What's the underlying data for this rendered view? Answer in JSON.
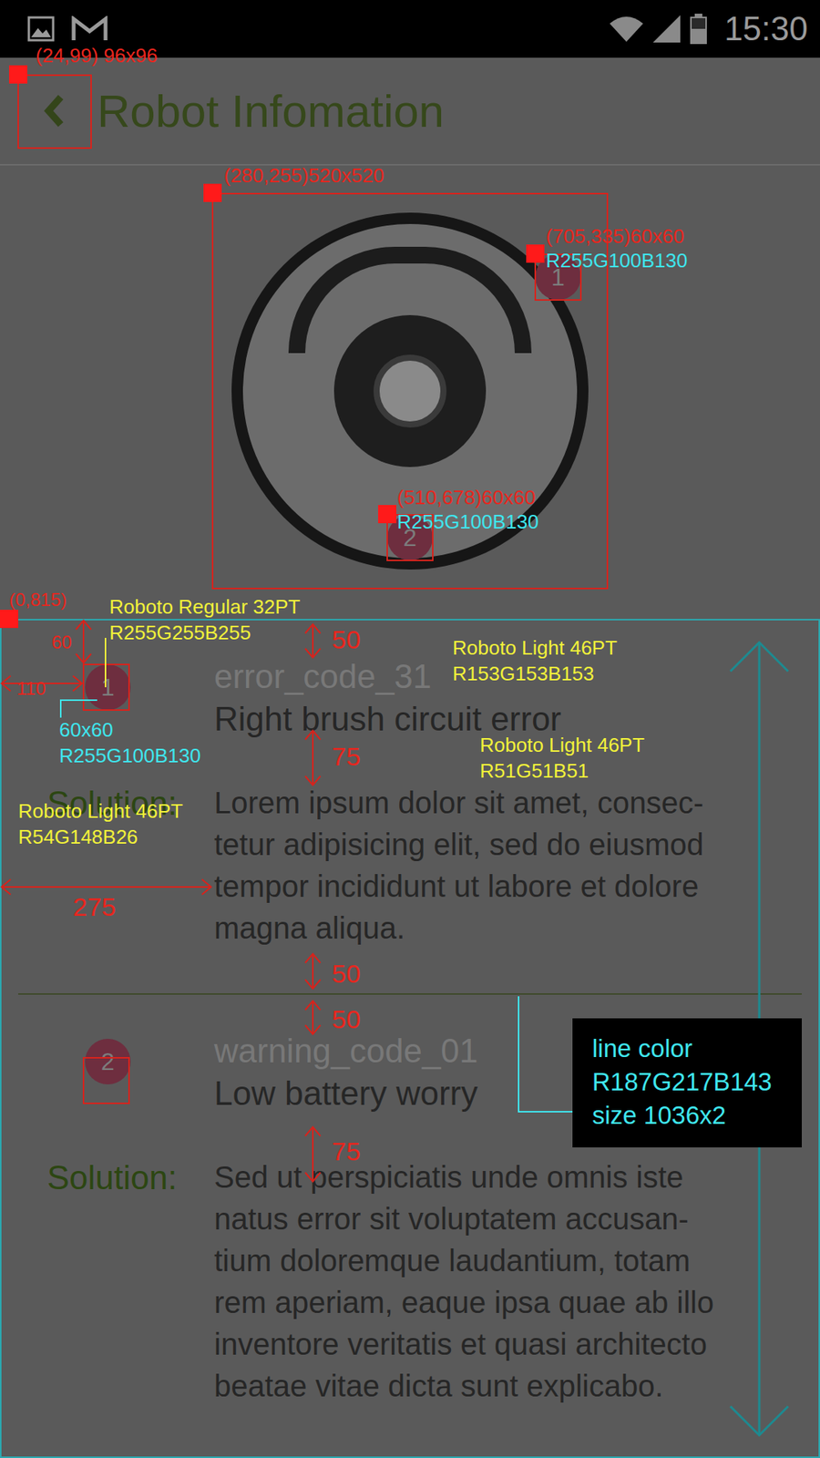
{
  "status_bar": {
    "time": "15:30"
  },
  "header": {
    "title": "Robot Infomation"
  },
  "robot": {
    "markers": [
      {
        "label": "1"
      },
      {
        "label": "2"
      }
    ]
  },
  "items": [
    {
      "badge": "1",
      "code": "error_code_31",
      "title": "Right brush circuit error",
      "solution_label": "Solution:",
      "solution_lines": [
        "Lorem ipsum dolor sit amet, consec-",
        "tetur adipisicing elit, sed do eiusmod",
        "tempor incididunt ut labore et dolore",
        "magna aliqua."
      ]
    },
    {
      "badge": "2",
      "code": "warning_code_01",
      "title": "Low battery worry",
      "solution_label": "Solution:",
      "solution_lines": [
        "Sed ut perspiciatis unde omnis iste",
        "natus error sit voluptatem accusan-",
        "tium doloremque laudantium, totam",
        "rem aperiam, eaque ipsa quae ab illo",
        "inventore veritatis et quasi architecto",
        "beatae vitae dicta sunt explicabo."
      ]
    }
  ],
  "spec_note": {
    "lines": [
      "line color",
      "R187G217B143",
      "size 1036x2"
    ]
  },
  "annotations": [
    {
      "text": "(24,99) 96x96",
      "color": "#e8261e"
    },
    {
      "text": "(280,255)520x520",
      "color": "#e8261e"
    },
    {
      "text": "(705,335)60x60",
      "color": "#e8261e"
    },
    {
      "text": "R255G100B130",
      "color": "#3fe6ee"
    },
    {
      "text": "(510,678)60x60",
      "color": "#e8261e"
    },
    {
      "text": "R255G100B130",
      "color": "#3fe6ee"
    },
    {
      "text": "(0,815)",
      "color": "#e8261e"
    },
    {
      "text": "Roboto Regular 32PT",
      "color": "#f2f23a"
    },
    {
      "text": "R255G255B255",
      "color": "#f2f23a"
    },
    {
      "text": "60",
      "color": "#e8261e"
    },
    {
      "text": "110",
      "color": "#e8261e"
    },
    {
      "text": "50",
      "color": "#e8261e"
    },
    {
      "text": "Roboto Light 46PT",
      "color": "#f2f23a"
    },
    {
      "text": "R153G153B153",
      "color": "#f2f23a"
    },
    {
      "text": "60x60",
      "color": "#3fe6ee"
    },
    {
      "text": "R255G100B130",
      "color": "#3fe6ee"
    },
    {
      "text": "Roboto Light 46PT",
      "color": "#f2f23a"
    },
    {
      "text": "R51G51B51",
      "color": "#f2f23a"
    },
    {
      "text": "75",
      "color": "#e8261e"
    },
    {
      "text": "Roboto Light 46PT",
      "color": "#f2f23a"
    },
    {
      "text": "R54G148B26",
      "color": "#f2f23a"
    },
    {
      "text": "275",
      "color": "#e8261e"
    },
    {
      "text": "50",
      "color": "#e8261e"
    },
    {
      "text": "50",
      "color": "#e8261e"
    },
    {
      "text": "75",
      "color": "#e8261e"
    }
  ]
}
